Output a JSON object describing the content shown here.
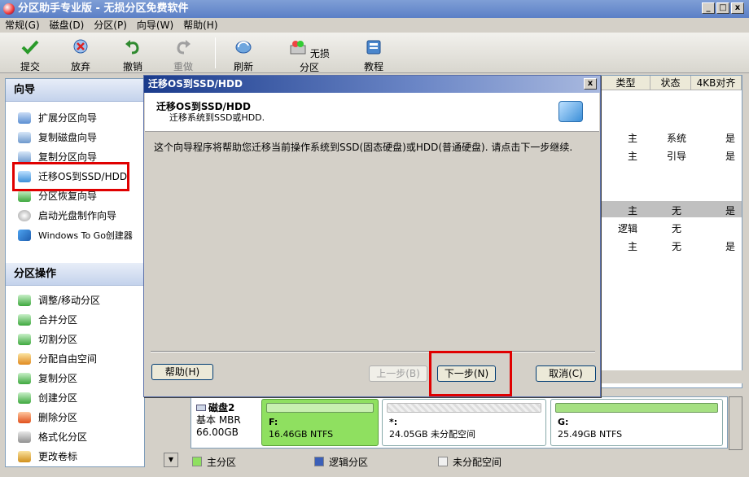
{
  "window": {
    "title": "分区助手专业版 - 无损分区免费软件"
  },
  "menu": [
    "常规(G)",
    "磁盘(D)",
    "分区(P)",
    "向导(W)",
    "帮助(H)"
  ],
  "toolbar": {
    "commit": "提交",
    "discard": "放弃",
    "undo": "撤销",
    "redo": "重做",
    "refresh": "刷新",
    "lossless": "无损分区",
    "tutorial": "教程"
  },
  "wizard_panel": {
    "title": "向导",
    "items": [
      "扩展分区向导",
      "复制磁盘向导",
      "复制分区向导",
      "迁移OS到SSD/HDD",
      "分区恢复向导",
      "启动光盘制作向导",
      "Windows To Go创建器"
    ]
  },
  "ops_panel": {
    "title": "分区操作",
    "items": [
      "调整/移动分区",
      "合并分区",
      "切割分区",
      "分配自由空间",
      "复制分区",
      "创建分区",
      "删除分区",
      "格式化分区",
      "更改卷标"
    ]
  },
  "table": {
    "headers": [
      "类型",
      "状态",
      "4KB对齐"
    ],
    "rows": [
      [
        "主",
        "系统",
        "是"
      ],
      [
        "主",
        "引导",
        "是"
      ],
      [
        "主",
        "无",
        "是"
      ],
      [
        "逻辑",
        "无",
        ""
      ],
      [
        "主",
        "无",
        "是"
      ]
    ]
  },
  "disk": {
    "name": "磁盘2",
    "type": "基本 MBR",
    "size": "66.00GB",
    "partitions": [
      {
        "label": "F:",
        "detail": "16.46GB NTFS"
      },
      {
        "label": "*:",
        "detail": "24.05GB 未分配空间"
      },
      {
        "label": "G:",
        "detail": "25.49GB NTFS"
      }
    ]
  },
  "legend": {
    "primary": "主分区",
    "logical": "逻辑分区",
    "unallocated": "未分配空间"
  },
  "dialog": {
    "title": "迁移OS到SSD/HDD",
    "heading": "迁移OS到SSD/HDD",
    "subheading": "迁移系统到SSD或HDD.",
    "body": "这个向导程序将帮助您迁移当前操作系统到SSD(固态硬盘)或HDD(普通硬盘). 请点击下一步继续.",
    "help": "帮助(H)",
    "back": "上一步(B)",
    "next": "下一步(N)",
    "cancel": "取消(C)"
  },
  "colors": {
    "accent": "#e00000",
    "primary_partition": "#8fe060",
    "title_bar": "#1a3b8c"
  }
}
